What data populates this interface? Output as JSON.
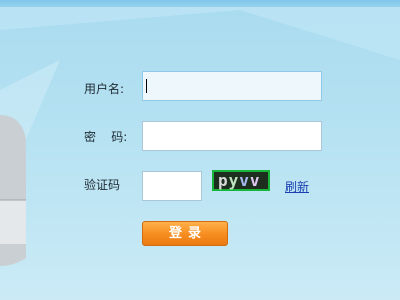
{
  "login_form": {
    "username_label": "用户名:",
    "password_label": "密    码:",
    "captcha_label": "验证码",
    "username_value": "",
    "password_value": "",
    "captcha_value": "",
    "captcha_chars": [
      "p",
      "y",
      "v",
      "v"
    ],
    "refresh_label": "刷新",
    "login_label": "登录"
  },
  "colors": {
    "top_bar": "#2d9bd8",
    "background": "#b6e2f2",
    "login_button": "#f68c1f",
    "captcha_border": "#19b53a",
    "link": "#1a3fb0"
  }
}
